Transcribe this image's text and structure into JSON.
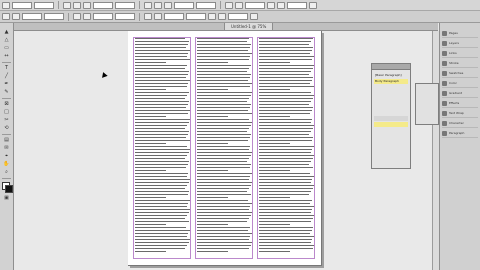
{
  "document": {
    "tab_title": "Untitled-1 @ 75%"
  },
  "styles_panel": {
    "items": [
      "[Basic Paragraph]",
      "Body Paragraph"
    ]
  },
  "right_panel": {
    "items": [
      "Pages",
      "Layers",
      "Links",
      "Stroke",
      "Swatches",
      "Color",
      "Gradient",
      "Effects",
      "Text Wrap",
      "Character",
      "Paragraph"
    ]
  },
  "colors": {
    "accent_selected": "#f4ea8a",
    "frame_edge": "#bb88cc"
  }
}
